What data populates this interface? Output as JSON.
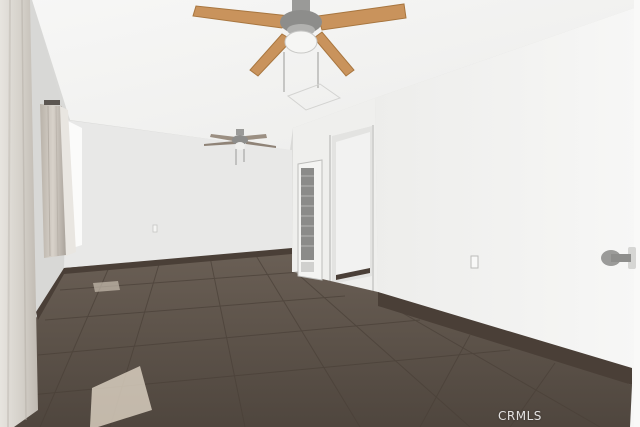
{
  "photo": {
    "watermark": "CRMLS",
    "palette": {
      "ceiling": "#f3f3f1",
      "wall_right": "#f1f1ef",
      "wall_back": "#eaeaea",
      "wall_left": "#dcdcdb",
      "floor": "#5f544a",
      "baseboard": "#4a3f37",
      "fan_blade": "#c9935c",
      "fan_metal": "#9a9a98",
      "curtain": "#cbc5bc"
    },
    "icons": [
      "ceiling-fan-icon",
      "wall-heater-icon",
      "door-handle-icon",
      "outlet-icon"
    ]
  }
}
